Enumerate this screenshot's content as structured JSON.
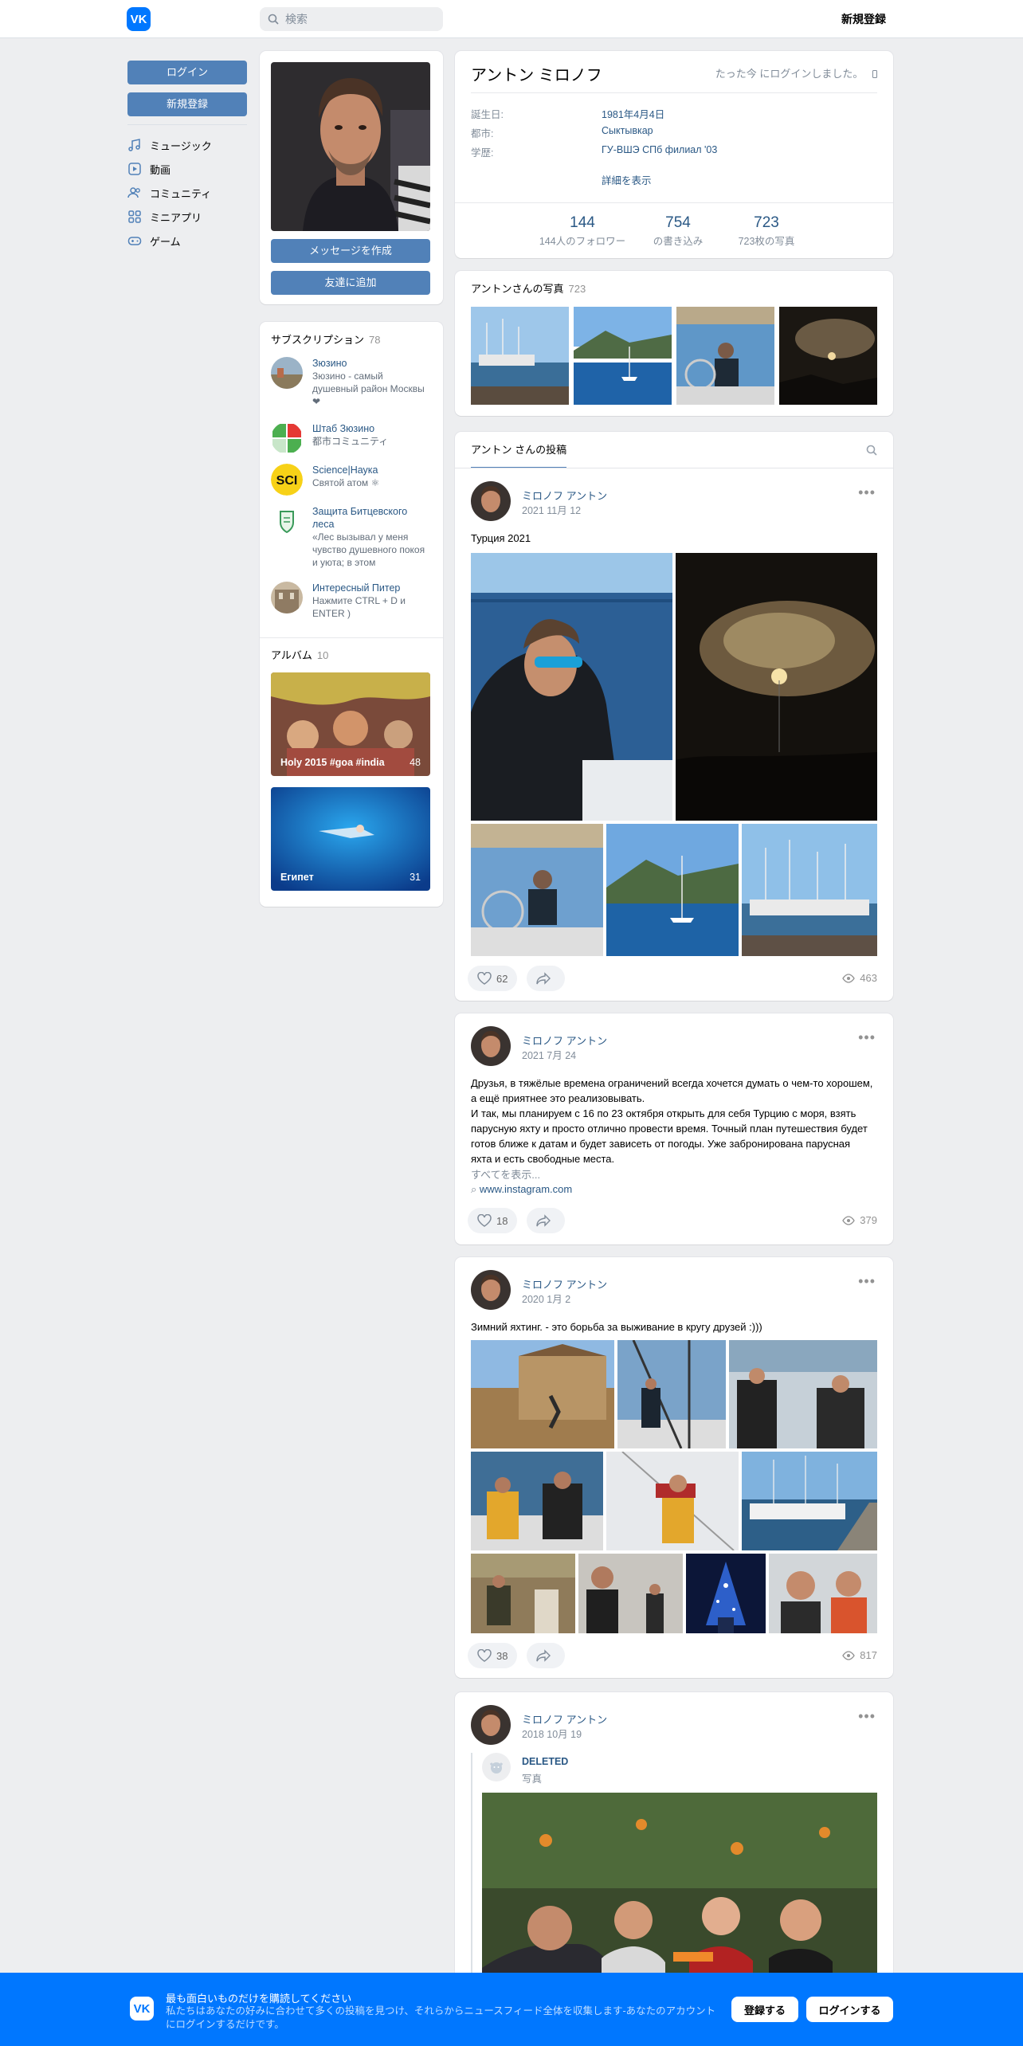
{
  "header": {
    "logo": "VK",
    "search_placeholder": "検索",
    "register": "新規登録"
  },
  "leftnav": {
    "login": "ログイン",
    "register": "新規登録",
    "items": [
      {
        "label": "ミュージック",
        "icon": "music-icon"
      },
      {
        "label": "動画",
        "icon": "video-icon"
      },
      {
        "label": "コミュニティ",
        "icon": "community-icon"
      },
      {
        "label": "ミニアプリ",
        "icon": "miniapps-icon"
      },
      {
        "label": "ゲーム",
        "icon": "games-icon"
      }
    ]
  },
  "profile_side": {
    "message_btn": "メッセージを作成",
    "add_friend_btn": "友達に追加",
    "subs_title": "サブスクリプション",
    "subs_count": "78",
    "subs": [
      {
        "name": "Зюзино",
        "desc": "Зюзино - самый душевный район Москвы ❤"
      },
      {
        "name": "Штаб Зюзино",
        "desc": "都市コミュニティ"
      },
      {
        "name": "Science|Наука",
        "desc": "Святой атом ⚛"
      },
      {
        "name": "Защита Битцевского леса",
        "desc": "«Лес вызывал у меня чувство душевного покоя и уюта; в этом"
      },
      {
        "name": "Интересный Питер",
        "desc": "Нажмите CTRL + D и ENTER )"
      }
    ],
    "albums_title": "アルバム",
    "albums_count": "10",
    "albums": [
      {
        "title": "Holy 2015 #goa #india",
        "count": "48"
      },
      {
        "title": "Египет",
        "count": "31"
      }
    ]
  },
  "profile": {
    "name": "アントン ミロノフ",
    "online": "たった今 にログインしました。",
    "rows": [
      {
        "label": "誕生日:",
        "value": "1981年4月4日"
      },
      {
        "label": "都市:",
        "value": "Сыктывкар"
      },
      {
        "label": "学歴:",
        "value": "ГУ-ВШЭ СПб филиал '03"
      }
    ],
    "more": "詳細を表示",
    "stats": [
      {
        "num": "144",
        "label": "144人のフォロワー"
      },
      {
        "num": "754",
        "label": "の書き込み"
      },
      {
        "num": "723",
        "label": "723枚の写真"
      }
    ]
  },
  "photos": {
    "title": "アントンさんの写真",
    "count": "723"
  },
  "wall": {
    "tab": "アントン さんの投稿"
  },
  "posts": [
    {
      "author": "ミロノフ アントン",
      "date": "2021 11月 12",
      "text": "Турция 2021",
      "likes": "62",
      "views": "463"
    },
    {
      "author": "ミロノフ アントン",
      "date": "2021 7月 24",
      "lines": [
        "Друзья, в тяжёлые времена ограничений всегда хочется думать о чем-то хорошем,",
        "а ещё приятнее это реализовывать.",
        "И так, мы планируем с 16 по 23 октября открыть для себя Турцию с моря, взять",
        "парусную яхту и просто отлично провести время. Точный план путешествия будет",
        "готов ближе к датам и будет зависеть от погоды. Уже забронирована парусная",
        "яхта и есть свободные места."
      ],
      "show_more": "すべてを表示...",
      "link": "www.instagram.com",
      "likes": "18",
      "views": "379"
    },
    {
      "author": "ミロノフ アントン",
      "date": "2020 1月 2",
      "text": "Зимний яхтинг. - это борьба за выживание в кругу друзей :)))",
      "likes": "38",
      "views": "817"
    },
    {
      "author": "ミロノフ アントン",
      "date": "2018 10月 19",
      "repost_author": "DELETED",
      "repost_sub": "写真"
    }
  ],
  "bottom": {
    "title": "最も面白いものだけを購読してください",
    "text": "私たちはあなたの好みに合わせて多くの投稿を見つけ、それらからニュースフィード全体を収集します-あなたのアカウントにログインするだけです。",
    "register": "登録する",
    "login": "ログインする"
  },
  "colors": {
    "accent": "#5181b8",
    "link": "#2a5885",
    "brand": "#0077ff"
  }
}
